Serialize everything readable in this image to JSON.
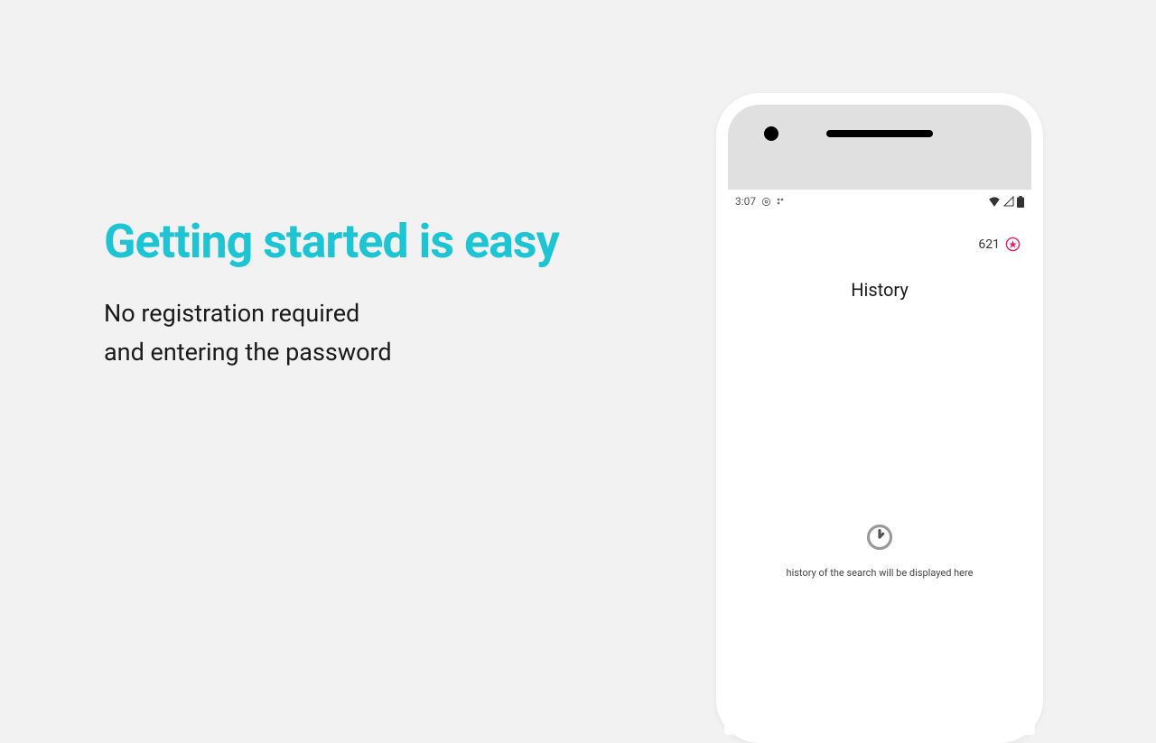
{
  "marketing": {
    "headline": "Getting started is easy",
    "subline_1": "No registration required",
    "subline_2": "and entering the password"
  },
  "phone": {
    "status": {
      "time": "3:07"
    },
    "points": {
      "value": "621"
    },
    "screen": {
      "title": "History",
      "empty_text": "history of the search will be displayed here"
    }
  }
}
